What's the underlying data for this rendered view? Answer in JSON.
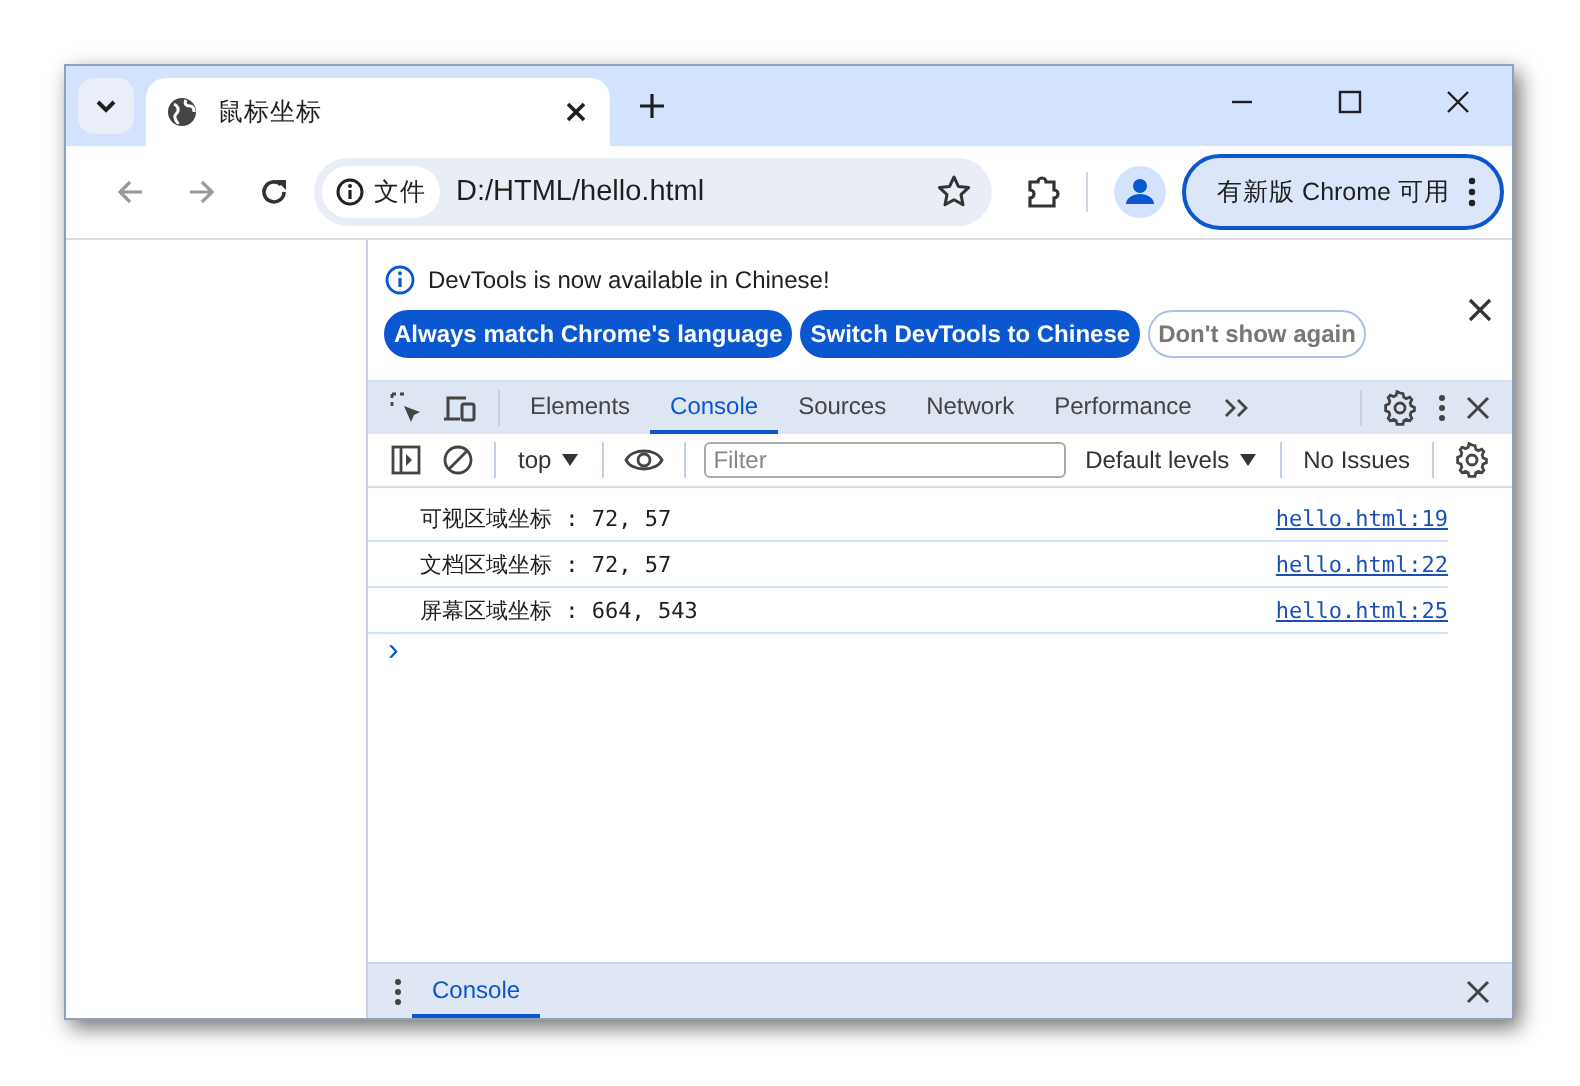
{
  "window": {
    "tab": {
      "title": "鼠标坐标"
    },
    "address": {
      "chip": "文件",
      "url": "D:/HTML/hello.html"
    },
    "update_button": "有新版 Chrome 可用"
  },
  "devtools": {
    "infobar": {
      "message": "DevTools is now available in Chinese!",
      "buttons": [
        {
          "label": "Always match Chrome's language",
          "kind": "primary"
        },
        {
          "label": "Switch DevTools to Chinese",
          "kind": "primary"
        },
        {
          "label": "Don't show again",
          "kind": "outline"
        }
      ]
    },
    "tabs": [
      {
        "label": "Elements",
        "selected": false
      },
      {
        "label": "Console",
        "selected": true
      },
      {
        "label": "Sources",
        "selected": false
      },
      {
        "label": "Network",
        "selected": false
      },
      {
        "label": "Performance",
        "selected": false
      }
    ],
    "console_toolbar": {
      "context": "top",
      "filter": {
        "placeholder": "Filter"
      },
      "levels": "Default levels",
      "issues": "No Issues"
    },
    "messages": [
      {
        "text": "可视区域坐标 : 72, 57",
        "source": "hello.html:19"
      },
      {
        "text": "文档区域坐标 : 72, 57",
        "source": "hello.html:22"
      },
      {
        "text": "屏幕区域坐标 : 664, 543",
        "source": "hello.html:25"
      }
    ],
    "prompt": "›",
    "drawer": {
      "tabs": [
        {
          "label": "Console",
          "selected": true
        }
      ]
    }
  }
}
